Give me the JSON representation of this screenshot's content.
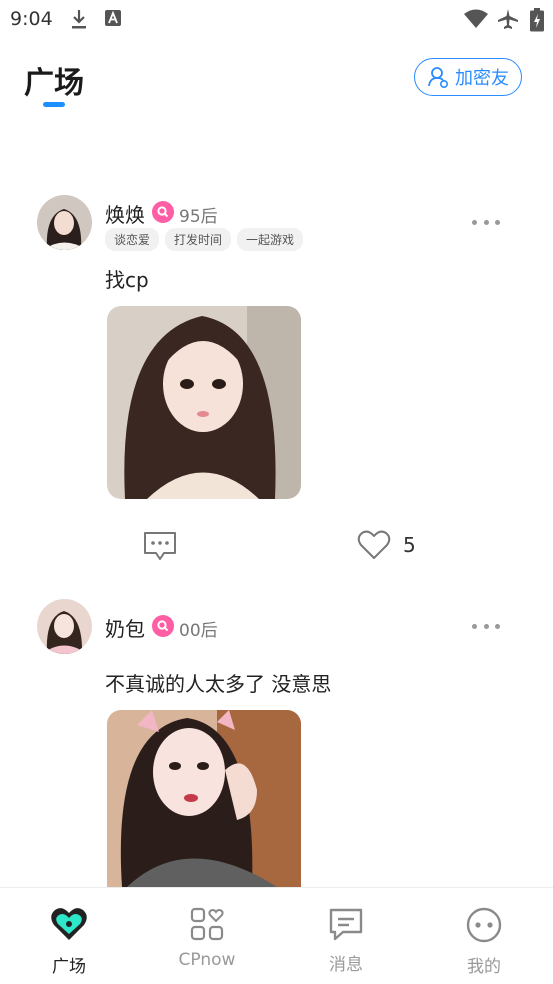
{
  "status_bar": {
    "time": "9:04"
  },
  "header": {
    "title": "广场",
    "add_friend_label": "加密友"
  },
  "posts": [
    {
      "username": "焕焕",
      "age": "95后",
      "tags": [
        "谈恋爱",
        "打发时间",
        "一起游戏"
      ],
      "text": "找cp",
      "likes": "5"
    },
    {
      "username": "奶包",
      "age": "00后",
      "tags": [],
      "text": "不真诚的人太多了 没意思"
    }
  ],
  "nav": {
    "items": [
      {
        "label": "广场",
        "icon": "heart-square-icon",
        "active": true
      },
      {
        "label": "CPnow",
        "icon": "grid-heart-icon",
        "active": false
      },
      {
        "label": "消息",
        "icon": "message-icon",
        "active": false
      },
      {
        "label": "我的",
        "icon": "face-icon",
        "active": false
      }
    ]
  },
  "colors": {
    "accent": "#1e8fff",
    "badge": "#ff5ea5",
    "teal": "#2ee6c8"
  }
}
